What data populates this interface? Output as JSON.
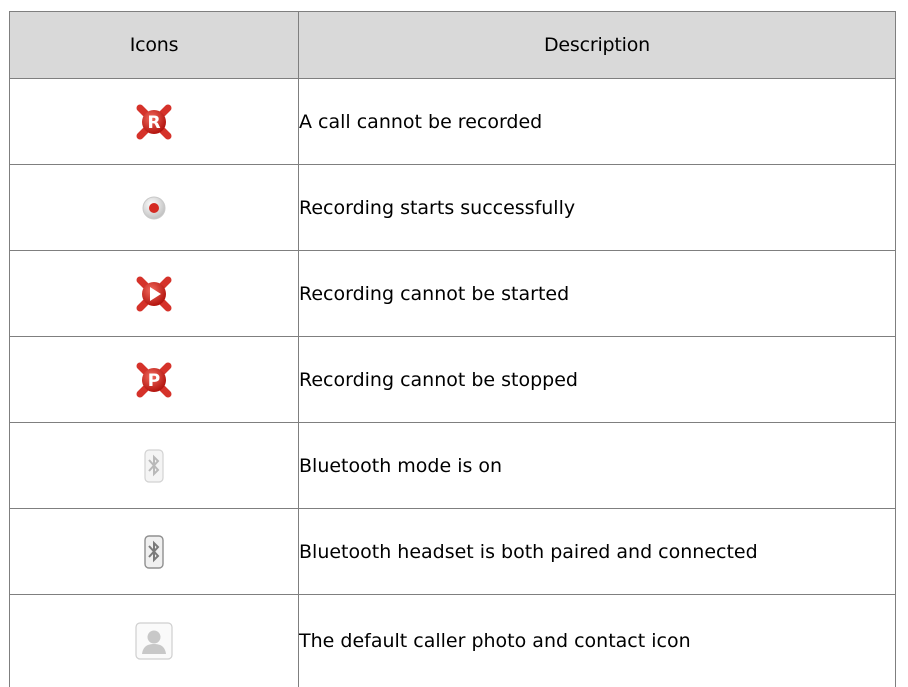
{
  "table": {
    "headers": {
      "icons": "Icons",
      "description": "Description"
    },
    "rows": [
      {
        "icon": "record-blocked-r-icon",
        "description": "A call cannot be recorded"
      },
      {
        "icon": "recording-dot-icon",
        "description": "Recording starts successfully"
      },
      {
        "icon": "record-start-blocked-play-icon",
        "description": "Recording cannot be started"
      },
      {
        "icon": "record-stop-blocked-p-icon",
        "description": "Recording cannot be stopped"
      },
      {
        "icon": "bluetooth-on-icon",
        "description": "Bluetooth mode is on"
      },
      {
        "icon": "bluetooth-connected-icon",
        "description": "Bluetooth headset is both paired and connected"
      },
      {
        "icon": "default-contact-photo-icon",
        "description": "The default caller photo and contact icon"
      }
    ]
  },
  "colors": {
    "header_bg": "#d9d9d9",
    "border": "#7f7f7f",
    "record_red": "#d42a22"
  },
  "icon_letters": {
    "r": "R",
    "p": "P"
  }
}
